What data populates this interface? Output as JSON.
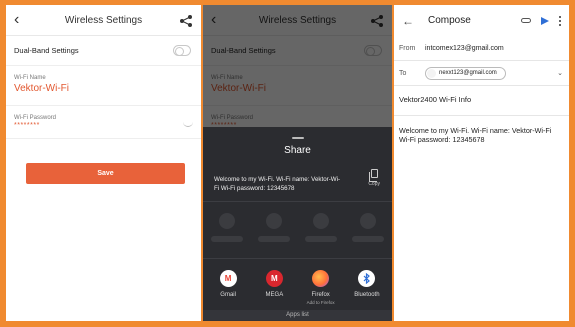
{
  "settings": {
    "title": "Wireless Settings",
    "back_icon": "back-arrow-icon",
    "share_icon": "share-icon",
    "dual_band_label": "Dual-Band Settings",
    "dual_band_on": false,
    "wifi_name_label": "Wi-Fi Name",
    "wifi_name_value": "Vektor-Wi-Fi",
    "wifi_password_label": "Wi-Fi Password",
    "wifi_password_value": "********",
    "save_label": "Save"
  },
  "share_sheet": {
    "title": "Share",
    "text": "Welcome to my Wi-Fi. Wi-Fi name: Vektor-Wi-Fi Wi-Fi password: 12345678",
    "copy_label": "Copy",
    "apps": [
      {
        "name": "Gmail",
        "sub": "",
        "icon": "gmail-icon",
        "color": "#ea4335",
        "glyph": "M"
      },
      {
        "name": "MEGA",
        "sub": "",
        "icon": "mega-icon",
        "color": "#d9272e",
        "glyph": "M"
      },
      {
        "name": "Firefox",
        "sub": "Add to Firefox",
        "icon": "firefox-icon",
        "color": "#ff7139",
        "glyph": ""
      },
      {
        "name": "Bluetooth",
        "sub": "",
        "icon": "bluetooth-icon",
        "color": "#ffffff",
        "glyph": "ʙ"
      }
    ],
    "apps_list_label": "Apps list"
  },
  "compose": {
    "title": "Compose",
    "from_label": "From",
    "from_value": "intcomex123@gmail.com",
    "to_label": "To",
    "to_value": "nexxt123@gmail.com",
    "subject": "Vektor2400 Wi-Fi Info",
    "body": "Welcome to my Wi-Fi. Wi-Fi name: Vektor-Wi-Fi Wi-Fi password: 12345678",
    "accent": "#2f6fd6"
  },
  "colors": {
    "frame": "#f08a30",
    "accent_orange": "#e8623a",
    "sheet_bg": "#2b2c30"
  }
}
